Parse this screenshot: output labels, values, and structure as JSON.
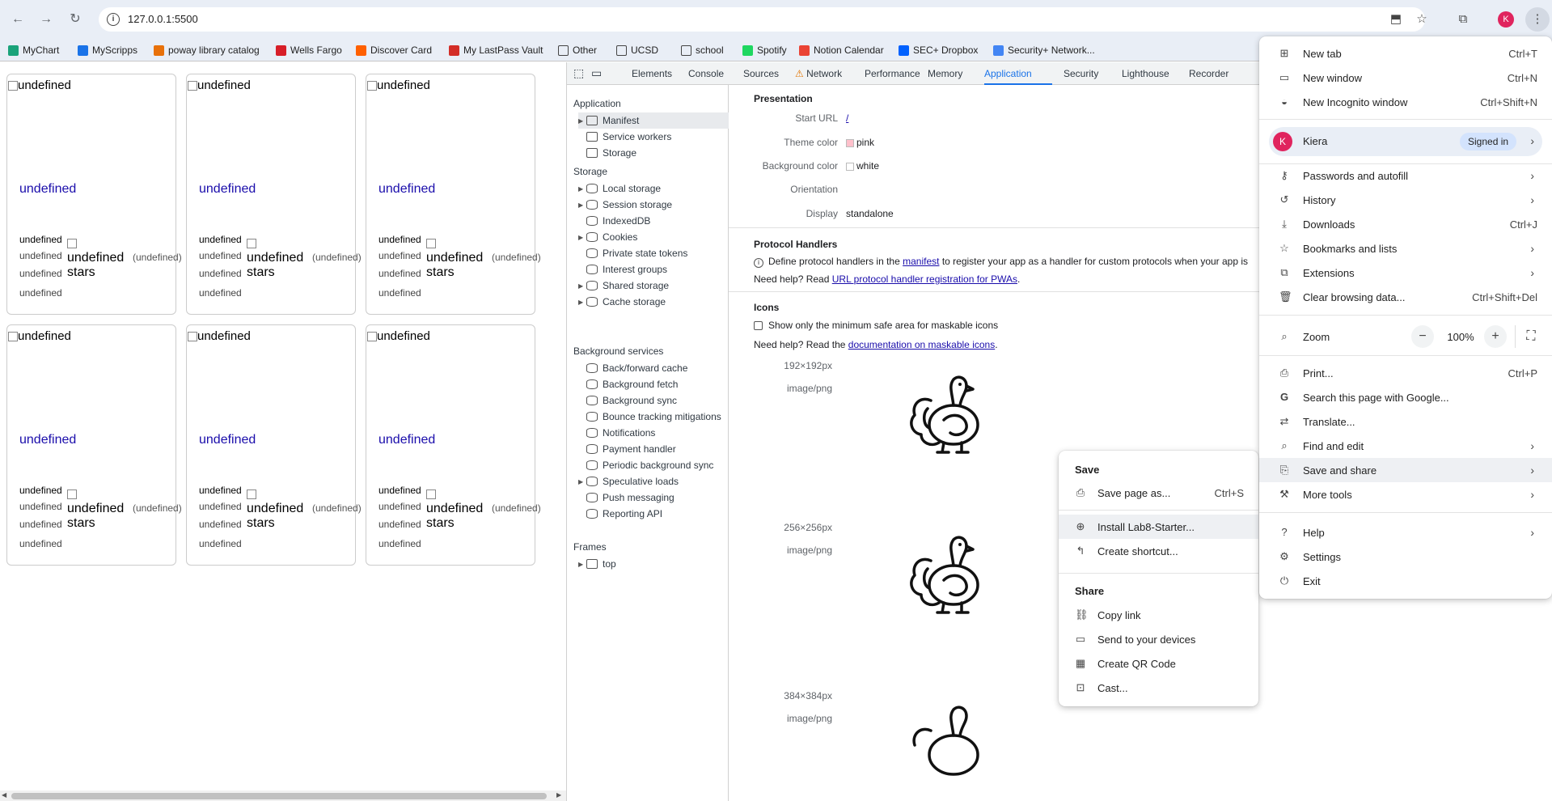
{
  "browser": {
    "url": "127.0.0.1:5500",
    "avatar_initial": "K",
    "bookmarks": [
      {
        "label": "MyChart",
        "color": "#1aa37a"
      },
      {
        "label": "MyScripps",
        "color": "#1a73e8"
      },
      {
        "label": "poway library catalog",
        "color": "#e8710a"
      },
      {
        "label": "Wells Fargo",
        "color": "#d71e28"
      },
      {
        "label": "Discover Card",
        "color": "#ff6000"
      },
      {
        "label": "My LastPass Vault",
        "color": "#d32d27"
      },
      {
        "label": "Other",
        "color": "folder"
      },
      {
        "label": "UCSD",
        "color": "folder"
      },
      {
        "label": "school",
        "color": "folder"
      },
      {
        "label": "Spotify",
        "color": "#1ed760"
      },
      {
        "label": "Notion Calendar",
        "color": "#ea4335"
      },
      {
        "label": "SEC+ Dropbox",
        "color": "#0061fe"
      },
      {
        "label": "Security+ Network...",
        "color": "#4285f4"
      }
    ]
  },
  "cards": [
    {
      "img_alt": "undefined",
      "title": "undefined",
      "l1": "undefined",
      "l2": "undefined",
      "l3": "undefined",
      "l4": "undefined",
      "stars": "undefined",
      "stars_suffix": "stars",
      "count": "(undefined)"
    },
    {
      "img_alt": "undefined",
      "title": "undefined",
      "l1": "undefined",
      "l2": "undefined",
      "l3": "undefined",
      "l4": "undefined",
      "stars": "undefined",
      "stars_suffix": "stars",
      "count": "(undefined)"
    },
    {
      "img_alt": "undefined",
      "title": "undefined",
      "l1": "undefined",
      "l2": "undefined",
      "l3": "undefined",
      "l4": "undefined",
      "stars": "undefined",
      "stars_suffix": "stars",
      "count": "(undefined)"
    },
    {
      "img_alt": "undefined",
      "title": "undefined",
      "l1": "undefined",
      "l2": "undefined",
      "l3": "undefined",
      "l4": "undefined",
      "stars": "undefined",
      "stars_suffix": "stars",
      "count": "(undefined)"
    },
    {
      "img_alt": "undefined",
      "title": "undefined",
      "l1": "undefined",
      "l2": "undefined",
      "l3": "undefined",
      "l4": "undefined",
      "stars": "undefined",
      "stars_suffix": "stars",
      "count": "(undefined)"
    },
    {
      "img_alt": "undefined",
      "title": "undefined",
      "l1": "undefined",
      "l2": "undefined",
      "l3": "undefined",
      "l4": "undefined",
      "stars": "undefined",
      "stars_suffix": "stars",
      "count": "(undefined)"
    }
  ],
  "devtools": {
    "tabs": [
      "Elements",
      "Console",
      "Sources",
      "Network",
      "Performance",
      "Memory",
      "Application",
      "Security",
      "Lighthouse",
      "Recorder"
    ],
    "active_tab": "Application",
    "sidebar": {
      "application_header": "Application",
      "application_items": [
        "Manifest",
        "Service workers",
        "Storage"
      ],
      "storage_header": "Storage",
      "storage_items": [
        "Local storage",
        "Session storage",
        "IndexedDB",
        "Cookies",
        "Private state tokens",
        "Interest groups",
        "Shared storage",
        "Cache storage"
      ],
      "bg_header": "Background services",
      "bg_items": [
        "Back/forward cache",
        "Background fetch",
        "Background sync",
        "Bounce tracking mitigations",
        "Notifications",
        "Payment handler",
        "Periodic background sync",
        "Speculative loads",
        "Push messaging",
        "Reporting API"
      ],
      "frames_header": "Frames",
      "frames_items": [
        "top"
      ]
    },
    "presentation": {
      "header": "Presentation",
      "start_url_label": "Start URL",
      "start_url_value": "/",
      "theme_color_label": "Theme color",
      "theme_color_value": "pink",
      "theme_color_hex": "#ffc0cb",
      "bg_color_label": "Background color",
      "bg_color_value": "white",
      "orientation_label": "Orientation",
      "orientation_value": "",
      "display_label": "Display",
      "display_value": "standalone"
    },
    "protocol": {
      "header": "Protocol Handlers",
      "text_pre": "Define protocol handlers in the",
      "link1": "manifest",
      "text_post": "to register your app as a handler for custom protocols when your app is",
      "help_pre": "Need help? Read",
      "link2": "URL protocol handler registration for PWAs",
      "help_post": "."
    },
    "icons": {
      "header": "Icons",
      "checkbox_label": "Show only the minimum safe area for maskable icons",
      "help_pre": "Need help? Read the",
      "link": "documentation on maskable icons",
      "help_post": ".",
      "entries": [
        {
          "size": "192×192px",
          "type": "image/png"
        },
        {
          "size": "256×256px",
          "type": "image/png"
        },
        {
          "size": "384×384px",
          "type": "image/png"
        }
      ]
    }
  },
  "save_share_menu": {
    "save_header": "Save",
    "save_page": "Save page as...",
    "save_page_shortcut": "Ctrl+S",
    "install": "Install Lab8-Starter...",
    "create_shortcut": "Create shortcut...",
    "share_header": "Share",
    "copy_link": "Copy link",
    "send_devices": "Send to your devices",
    "qr": "Create QR Code",
    "cast": "Cast..."
  },
  "main_menu": {
    "new_tab": "New tab",
    "new_tab_sc": "Ctrl+T",
    "new_window": "New window",
    "new_window_sc": "Ctrl+N",
    "incognito": "New Incognito window",
    "incognito_sc": "Ctrl+Shift+N",
    "profile_name": "Kiera",
    "profile_initial": "K",
    "profile_status": "Signed in",
    "passwords": "Passwords and autofill",
    "history": "History",
    "downloads": "Downloads",
    "downloads_sc": "Ctrl+J",
    "bookmarks": "Bookmarks and lists",
    "extensions": "Extensions",
    "clear": "Clear browsing data...",
    "clear_sc": "Ctrl+Shift+Del",
    "zoom_label": "Zoom",
    "zoom_value": "100%",
    "zoom_minus": "−",
    "zoom_plus": "+",
    "print": "Print...",
    "print_sc": "Ctrl+P",
    "search": "Search this page with Google...",
    "translate": "Translate...",
    "find": "Find and edit",
    "save_share": "Save and share",
    "more_tools": "More tools",
    "help": "Help",
    "settings": "Settings",
    "exit": "Exit"
  }
}
